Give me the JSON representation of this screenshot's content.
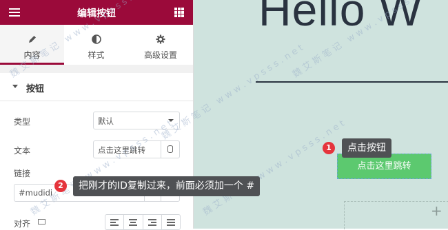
{
  "header": {
    "title": "编辑按钮",
    "menu_icon": "hamburger-icon",
    "apps_icon": "grid-icon"
  },
  "tabs": [
    {
      "label": "内容",
      "icon": "pencil-icon",
      "active": true
    },
    {
      "label": "样式",
      "icon": "half-circle-icon",
      "active": false
    },
    {
      "label": "高级设置",
      "icon": "gear-icon",
      "active": false
    }
  ],
  "section": {
    "title": "按钮"
  },
  "fields": {
    "type": {
      "label": "类型",
      "value": "默认"
    },
    "text": {
      "label": "文本",
      "value": "点击这里跳转"
    },
    "link": {
      "label": "链接",
      "value": "#mudidi"
    },
    "align": {
      "label": "对齐"
    }
  },
  "canvas": {
    "heading": "Hello W",
    "button_label": "点击这里跳转"
  },
  "annotations": [
    {
      "number": "1",
      "text": "点击按钮"
    },
    {
      "number": "2",
      "text": "把刚才的ID复制过来，前面必须加一个 #"
    }
  ],
  "colors": {
    "accent": "#9b0a3a",
    "canvas_bg": "#cfe3de",
    "button": "#5cc96f",
    "badge": "#e5343c"
  }
}
